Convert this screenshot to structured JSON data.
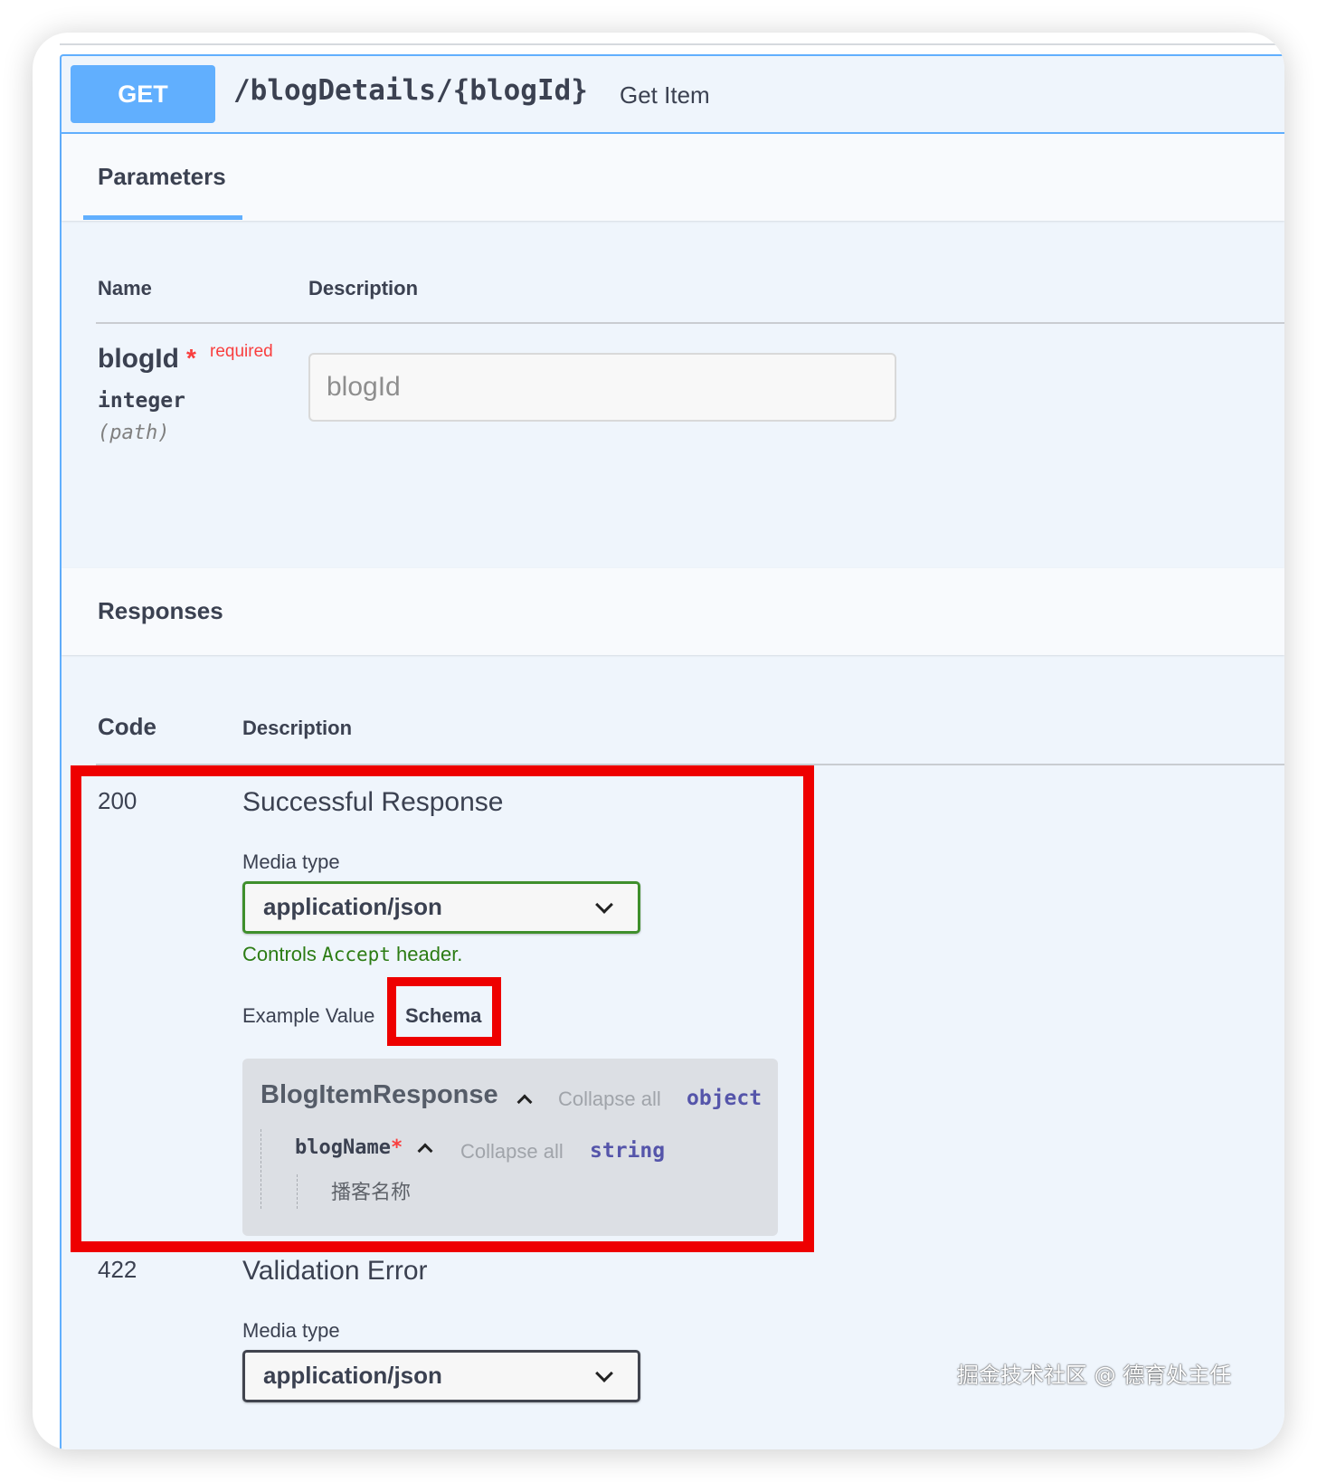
{
  "operation": {
    "method": "GET",
    "path": "/blogDetails/{blogId}",
    "summary": "Get Item"
  },
  "parameters": {
    "tab_label": "Parameters",
    "col_name": "Name",
    "col_description": "Description",
    "items": [
      {
        "name": "blogId",
        "required_star": "*",
        "required_label": "required",
        "type": "integer",
        "location": "(path)",
        "placeholder": "blogId"
      }
    ]
  },
  "responses": {
    "title": "Responses",
    "col_code": "Code",
    "col_description": "Description",
    "items": [
      {
        "code": "200",
        "description": "Successful Response",
        "media_type_label": "Media type",
        "media_type": "application/json",
        "controls_prefix": "Controls ",
        "controls_code": "Accept",
        "controls_suffix": " header.",
        "tab_example": "Example Value",
        "tab_schema": "Schema",
        "schema": {
          "model_name": "BlogItemResponse",
          "collapse_label": "Collapse all",
          "type": "object",
          "property": {
            "name": "blogName",
            "required_star": "*",
            "collapse_label": "Collapse all",
            "type": "string",
            "description": "播客名称"
          }
        }
      },
      {
        "code": "422",
        "description": "Validation Error",
        "media_type_label": "Media type",
        "media_type": "application/json"
      }
    ]
  },
  "watermark": "掘金技术社区 @ 德育处主任",
  "colors": {
    "get_method": "#61affe",
    "required": "#f93e3e",
    "controls_text": "#2c7c14",
    "highlight": "#ee0000",
    "type_keyword": "#5555aa"
  }
}
